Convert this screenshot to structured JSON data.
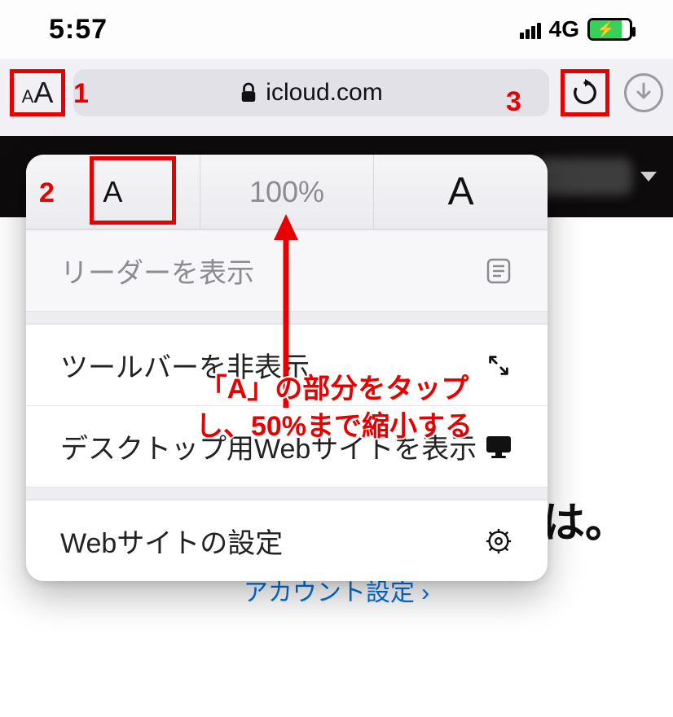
{
  "status": {
    "time": "5:57",
    "network": "4G"
  },
  "address_bar": {
    "aa_small": "A",
    "aa_big": "A",
    "domain": "icloud.com"
  },
  "popover": {
    "zoom_small_label": "A",
    "zoom_percent": "100%",
    "zoom_big_label": "A",
    "reader": "リーダーを表示",
    "hide_toolbar": "ツールバーを非表示",
    "request_desktop": "デスクトップ用Webサイトを表示",
    "website_settings": "Webサイトの設定"
  },
  "page": {
    "greeting_suffix": "さん、こんばんは。",
    "account_link": "アカウント設定 ›"
  },
  "annotations": {
    "n1": "1",
    "n2": "2",
    "n3": "3",
    "line1": "「A」の部分をタップ",
    "line2": "し、50%まで縮小する"
  }
}
